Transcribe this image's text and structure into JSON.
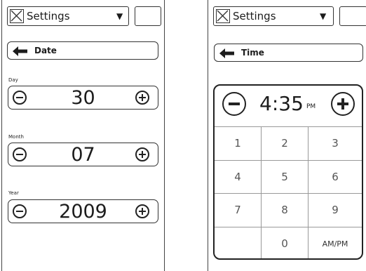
{
  "date_screen": {
    "header": {
      "select_label": "Settings"
    },
    "back_button": {
      "label": "Date"
    },
    "fields": [
      {
        "label": "Day",
        "value": "30"
      },
      {
        "label": "Month",
        "value": "07"
      },
      {
        "label": "Year",
        "value": "2009"
      }
    ]
  },
  "time_screen": {
    "header": {
      "select_label": "Settings"
    },
    "back_button": {
      "label": "Time"
    },
    "time": {
      "value": "4:35",
      "period": "PM"
    },
    "keypad": [
      "1",
      "2",
      "3",
      "4",
      "5",
      "6",
      "7",
      "8",
      "9",
      "",
      "0",
      "AM/PM"
    ]
  },
  "icons": {
    "select_icon": "x-box-icon",
    "caret": "caret-down-icon",
    "back": "back-arrow-icon",
    "decrement": "minus-circle-icon",
    "increment": "plus-circle-icon"
  }
}
